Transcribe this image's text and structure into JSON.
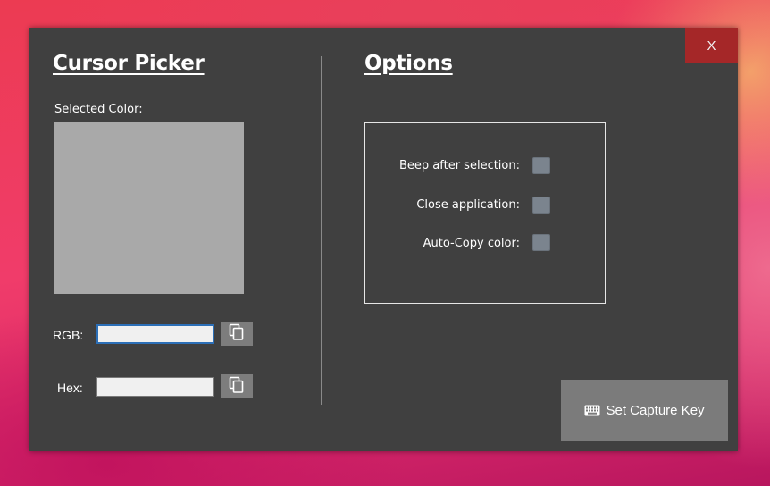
{
  "window": {
    "close_label": "X"
  },
  "left_panel": {
    "title": "Cursor Picker",
    "selected_color_label": "Selected Color:",
    "selected_color": "#a9a9a9",
    "rgb_label": "RGB:",
    "rgb_value": "",
    "hex_label": "Hex:",
    "hex_value": "",
    "copy_icon": "copy-icon"
  },
  "right_panel": {
    "title": "Options",
    "options": [
      {
        "label": "Beep after selection:",
        "checked": false
      },
      {
        "label": "Close application:",
        "checked": false
      },
      {
        "label": "Auto-Copy color:",
        "checked": false
      }
    ],
    "capture_button": {
      "icon": "keyboard-icon",
      "label": "Set Capture Key"
    }
  },
  "colors": {
    "window_bg": "#404040",
    "close_bg": "#a52728",
    "button_bg": "#7b7b7b",
    "checkbox_bg": "#7b848e"
  }
}
